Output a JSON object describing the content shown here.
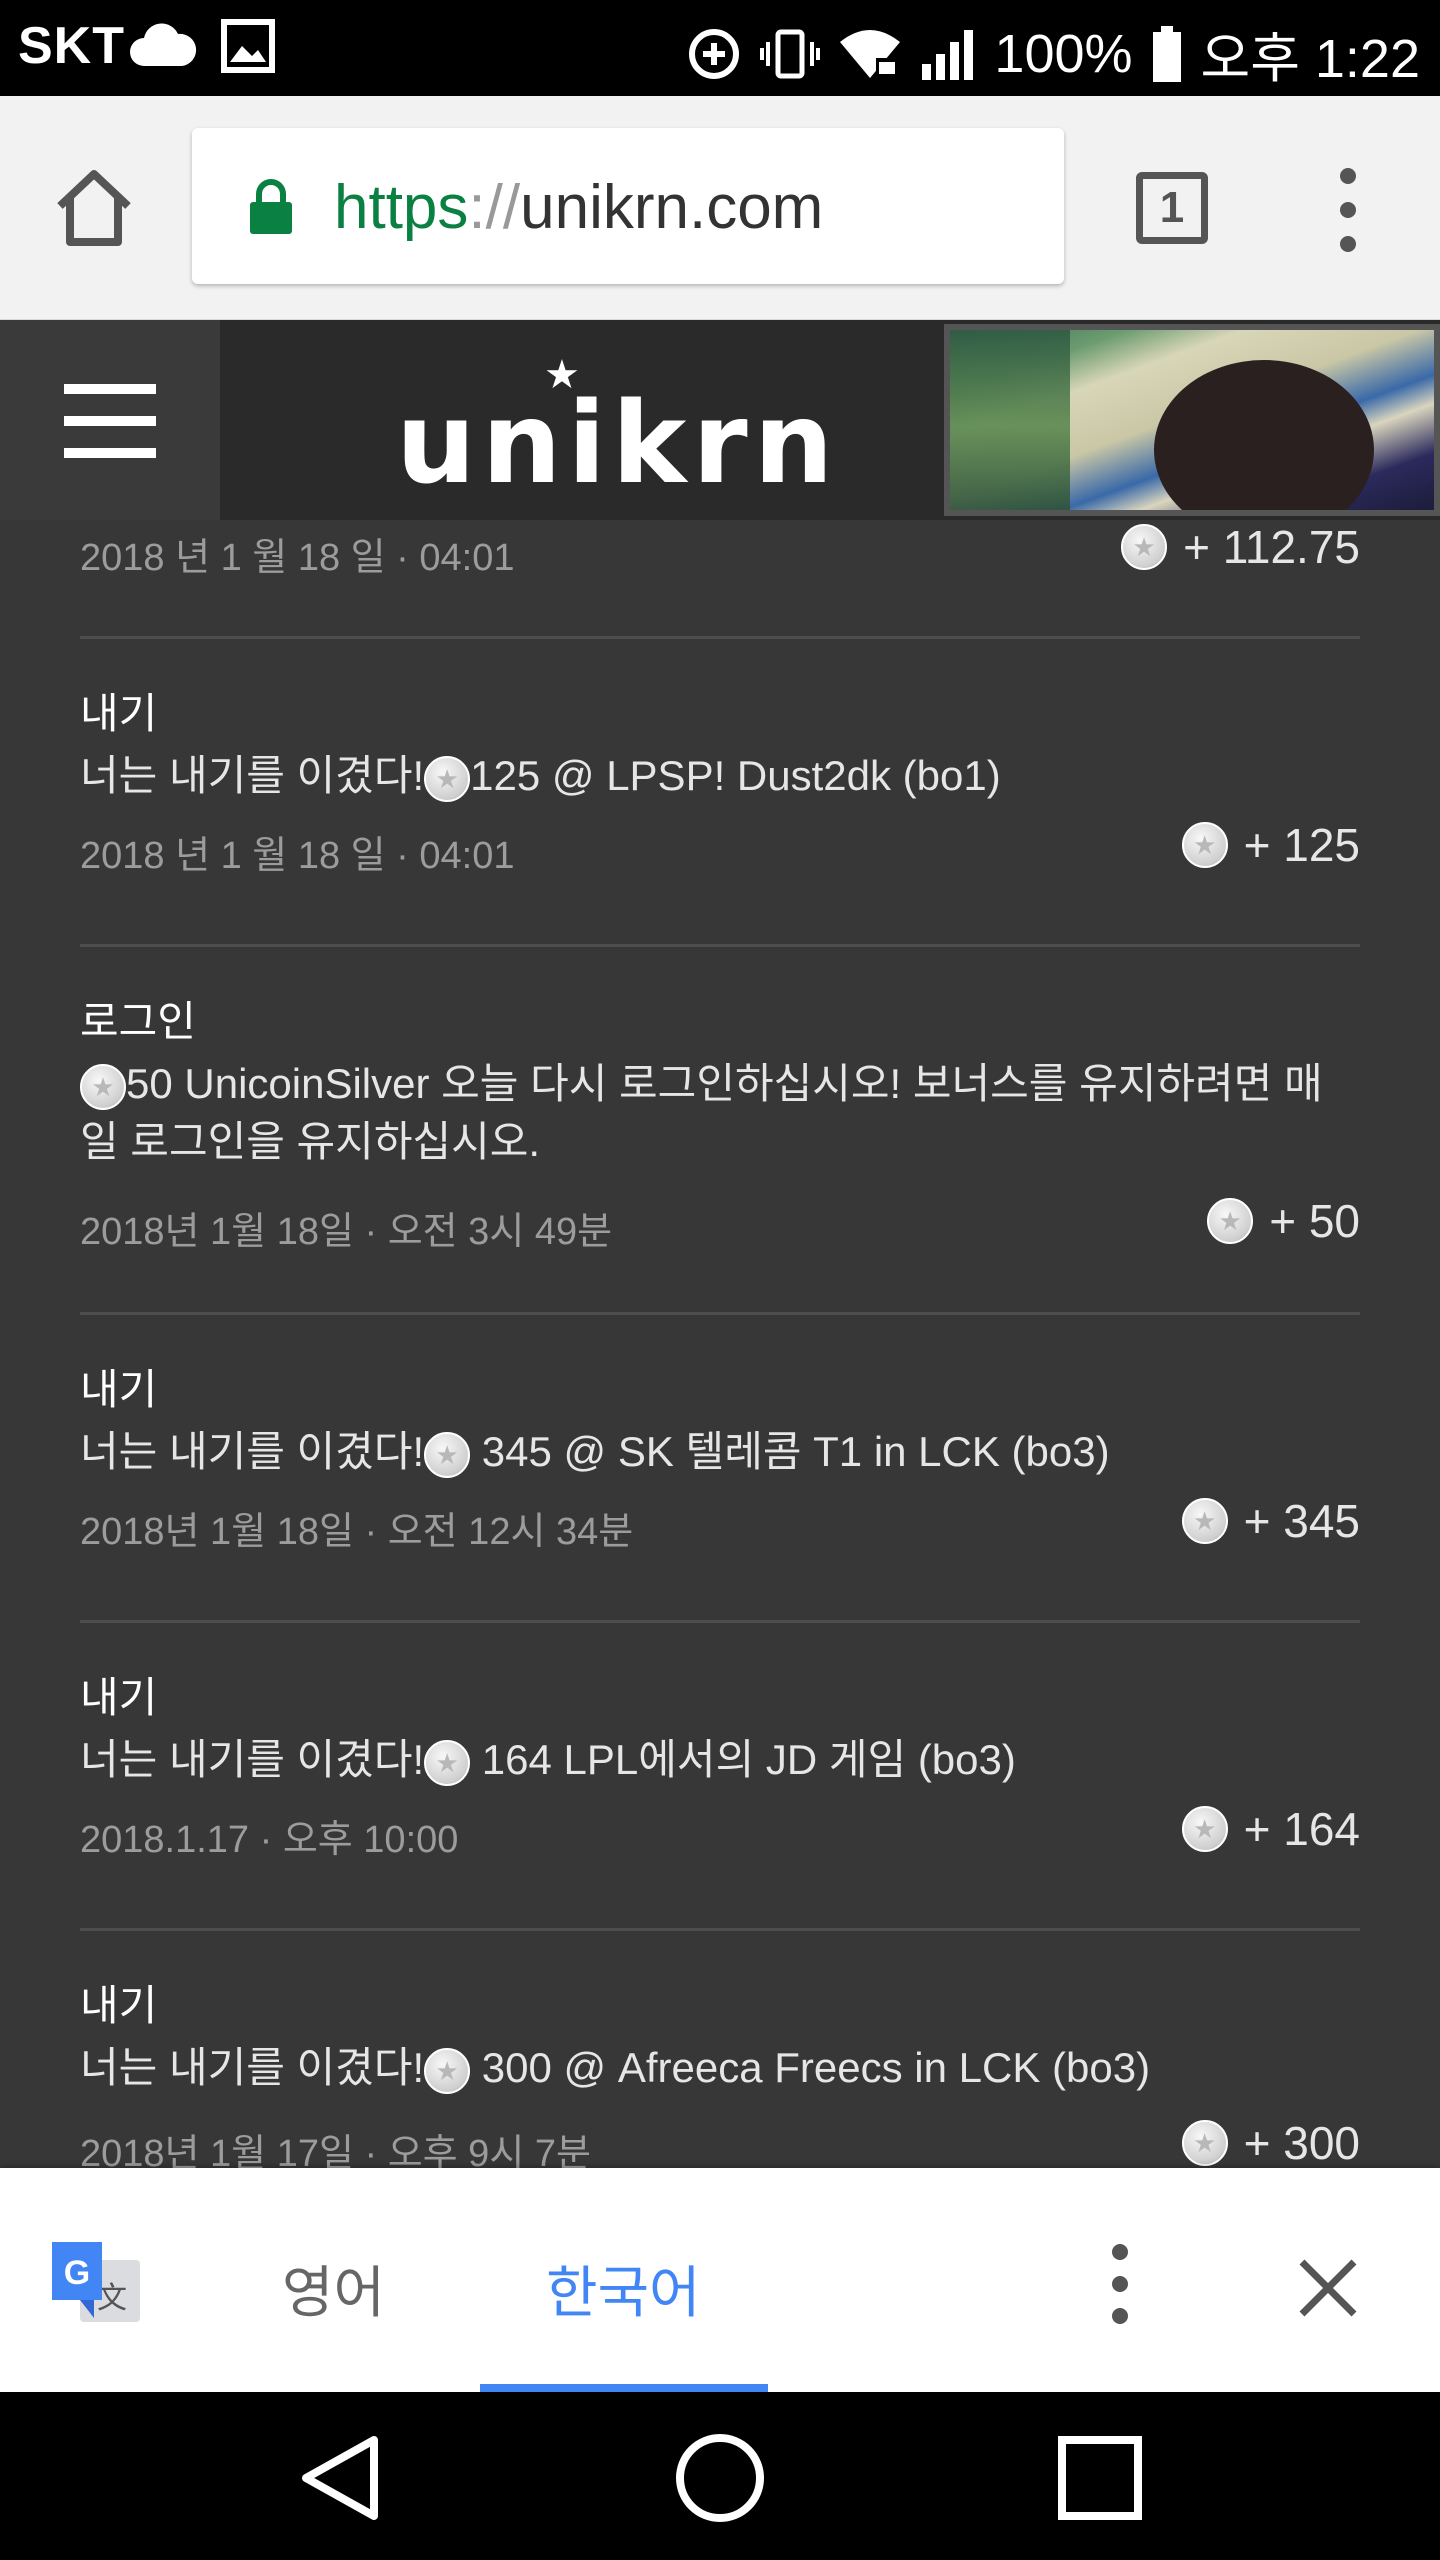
{
  "status_bar": {
    "carrier": "SKT",
    "battery": "100%",
    "time": "오후 1:22",
    "icons": [
      "cloud-icon",
      "image-icon",
      "data-saver-icon",
      "vibrate-icon",
      "wifi-locked-icon",
      "signal-icon",
      "battery-icon"
    ]
  },
  "browser": {
    "url_scheme": "https",
    "url_sep": "://",
    "url_host": "unikrn.com",
    "tab_count": "1",
    "icons": [
      "home-icon",
      "lock-icon",
      "tab-switcher-icon",
      "overflow-menu-icon"
    ]
  },
  "site": {
    "logo": "unikrn",
    "icons": [
      "hamburger-menu-icon"
    ]
  },
  "feed": {
    "partial_top": {
      "date": "2018 년 1 월 18 일 · 04:01",
      "amount": "+ 112.75"
    },
    "entries": [
      {
        "type": "내기",
        "desc_prefix": "너는 내기를 이겼다!",
        "desc_suffix": "125 @ LPSP! Dust2dk (bo1)",
        "date": "2018 년 1 월 18 일 · 04:01",
        "amount": "+ 125"
      },
      {
        "type": "로그인",
        "desc_prefix": "",
        "desc_suffix": "50 UnicoinSilver 오늘 다시 로그인하십시오! 보너스를 유지하려면 매일 로그인을 유지하십시오.",
        "date": "2018년 1월 18일 · 오전 3시 49분",
        "amount": "+ 50"
      },
      {
        "type": "내기",
        "desc_prefix": "너는 내기를 이겼다!",
        "desc_suffix": " 345 @ SK 텔레콤 T1 in LCK (bo3)",
        "date": "2018년 1월 18일 · 오전 12시 34분",
        "amount": "+ 345"
      },
      {
        "type": "내기",
        "desc_prefix": "너는 내기를 이겼다!",
        "desc_suffix": " 164 LPL에서의 JD 게임 (bo3)",
        "date": "2018.1.17 · 오후 10:00",
        "amount": "+ 164"
      },
      {
        "type": "내기",
        "desc_prefix": "너는 내기를 이겼다!",
        "desc_suffix": " 300 @ Afreeca Freecs in LCK (bo3)",
        "date": "2018년 1월 17일 · 오후 9시 7분",
        "amount": "+ 300"
      }
    ]
  },
  "translate_bar": {
    "source_lang": "영어",
    "target_lang": "한국어",
    "icons": [
      "google-translate-icon",
      "overflow-menu-icon",
      "close-icon"
    ]
  },
  "nav_bar": {
    "icons": [
      "back-icon",
      "home-circle-icon",
      "recents-icon"
    ]
  },
  "colors": {
    "feed_bg": "#373738",
    "header_bg": "#2a2a2b",
    "accent_blue": "#4285f4",
    "lock_green": "#0b8043"
  }
}
